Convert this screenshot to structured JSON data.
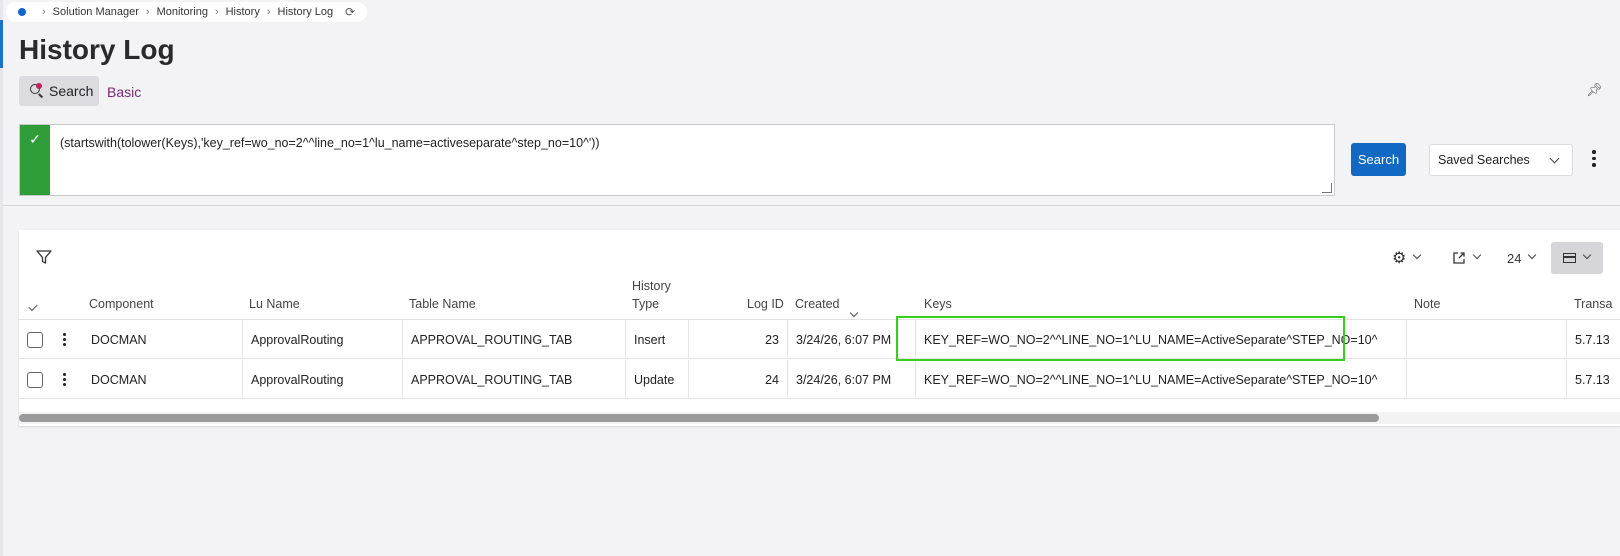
{
  "breadcrumb": {
    "items": [
      "Solution Manager",
      "Monitoring",
      "History",
      "History Log"
    ]
  },
  "page": {
    "title": "History Log"
  },
  "search_bar": {
    "toggle_label": "Search",
    "mode_link": "Basic",
    "query": "(startswith(tolower(Keys),'key_ref=wo_no=2^^line_no=1^lu_name=activeseparate^step_no=10^'))",
    "search_button": "Search",
    "saved_searches": "Saved Searches"
  },
  "toolbar": {
    "page_size": "24"
  },
  "table": {
    "headers": {
      "component": "Component",
      "lu_name": "Lu Name",
      "table_name": "Table Name",
      "history_type_1": "History",
      "history_type_2": "Type",
      "log_id": "Log ID",
      "created": "Created",
      "keys": "Keys",
      "note": "Note",
      "transaction": "Transa"
    },
    "rows": [
      {
        "component": "DOCMAN",
        "lu_name": "ApprovalRouting",
        "table_name": "APPROVAL_ROUTING_TAB",
        "history_type": "Insert",
        "log_id": "23",
        "created": "3/24/26, 6:07 PM",
        "keys": "KEY_REF=WO_NO=2^^LINE_NO=1^LU_NAME=ActiveSeparate^STEP_NO=10^",
        "note": "",
        "transaction": "5.7.13"
      },
      {
        "component": "DOCMAN",
        "lu_name": "ApprovalRouting",
        "table_name": "APPROVAL_ROUTING_TAB",
        "history_type": "Update",
        "log_id": "24",
        "created": "3/24/26, 6:07 PM",
        "keys": "KEY_REF=WO_NO=2^^LINE_NO=1^LU_NAME=ActiveSeparate^STEP_NO=10^",
        "note": "",
        "transaction": "5.7.13"
      }
    ]
  },
  "colors": {
    "accent": "#1269c3",
    "valid_green": "#2f9e3a",
    "highlight": "#36d01a",
    "link_purple": "#7a2a7c"
  }
}
